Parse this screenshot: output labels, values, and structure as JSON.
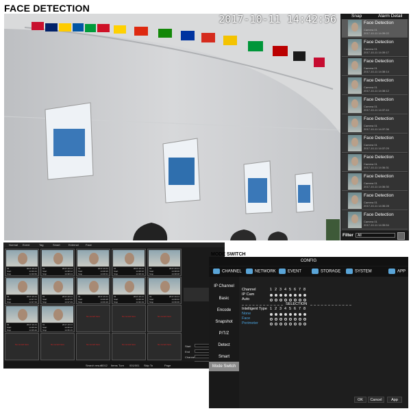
{
  "live_view": {
    "title": "FACE DETECTION",
    "timestamp": "2017-10-11 14:42:56",
    "tabs": {
      "snap": "Snap",
      "alarm_detail": "Alarm Detail"
    },
    "snaps": [
      {
        "event": "Face Detection",
        "camera": "Camera 01",
        "time": "2017-10-11 14:39:22"
      },
      {
        "event": "Face Detection",
        "camera": "Camera 01",
        "time": "2017-10-11 14:39:17"
      },
      {
        "event": "Face Detection",
        "camera": "Camera 01",
        "time": "2017-10-11 14:38:14"
      },
      {
        "event": "Face Detection",
        "camera": "Camera 01",
        "time": "2017-10-11 14:38:12"
      },
      {
        "event": "Face Detection",
        "camera": "Camera 01",
        "time": "2017-10-11 14:37:44"
      },
      {
        "event": "Face Detection",
        "camera": "Camera 01",
        "time": "2017-10-11 14:37:36"
      },
      {
        "event": "Face Detection",
        "camera": "Camera 01",
        "time": "2017-10-11 14:37:29"
      },
      {
        "event": "Face Detection",
        "camera": "Camera 01",
        "time": "2017-10-11 14:36:31"
      },
      {
        "event": "Face Detection",
        "camera": "Camera 01",
        "time": "2017-10-11 14:36:30"
      },
      {
        "event": "Face Detection",
        "camera": "Camera 01",
        "time": "2017-10-11 14:36:28"
      },
      {
        "event": "Face Detection",
        "camera": "Camera 01",
        "time": "2017-10-11 14:35:54"
      }
    ],
    "filter_label": "Filter",
    "filter_value": "All"
  },
  "search": {
    "tabs": [
      "Normal",
      "Event",
      "Tag",
      "Smart",
      "External",
      "Face"
    ],
    "cells": [
      {
        "ch": "01",
        "date": "2017-10-11",
        "start_lbl": "Start",
        "start": "14:39:44",
        "stop_lbl": "Stop",
        "stop": "14:39:50"
      },
      {
        "ch": "01",
        "date": "2017-10-11",
        "start_lbl": "Start",
        "start": "14:38:12",
        "stop_lbl": "Stop",
        "stop": "14:38:13"
      },
      {
        "ch": "01",
        "date": "2017-10-11",
        "start_lbl": "Start",
        "start": "14:38:25",
        "stop_lbl": "Stop",
        "stop": "14:38:31"
      },
      {
        "ch": "01",
        "date": "2017-10-11",
        "start_lbl": "Start",
        "start": "14:38:16",
        "stop_lbl": "Stop",
        "stop": "14:38:19"
      },
      {
        "ch": "01",
        "date": "2017-10-11",
        "start_lbl": "Start",
        "start": "14:38:06",
        "stop_lbl": "Stop",
        "stop": "14:38:08"
      },
      {
        "ch": "01",
        "date": "2017-10-11",
        "start_lbl": "Start",
        "start": "14:37:21",
        "stop_lbl": "Stop",
        "stop": "14:37:33"
      },
      {
        "ch": "01",
        "date": "2017-10-11",
        "start_lbl": "Start",
        "start": "14:37:05",
        "stop_lbl": "Stop",
        "stop": "14:37:09"
      },
      {
        "ch": "01",
        "date": "2017-10-11",
        "start_lbl": "Start",
        "start": "14:36:25",
        "stop_lbl": "Stop",
        "stop": "14:36:29"
      },
      {
        "ch": "01",
        "date": "2017-10-11",
        "start_lbl": "Start",
        "start": "14:36:16",
        "stop_lbl": "Stop",
        "stop": "14:36:19"
      },
      {
        "ch": "01",
        "date": "2017-10-11",
        "start_lbl": "Start",
        "start": "14:36:02",
        "stop_lbl": "Stop",
        "stop": "14:36:06"
      },
      {
        "ch": "01",
        "date": "2017-10-11",
        "start_lbl": "Start",
        "start": "14:35:34",
        "stop_lbl": "Stop",
        "stop": "14:35:40"
      },
      {
        "ch": "01",
        "date": "2017-10-11",
        "start_lbl": "Start",
        "start": "14:35:12",
        "stop_lbl": "Stop",
        "stop": "14:35:15"
      }
    ],
    "no_record": "No record here",
    "side": {
      "start": "Start",
      "end": "End",
      "channel": "Channel",
      "rec": "Rec"
    },
    "footer": {
      "result": "Search result",
      "result_val": "0012",
      "items": "Items",
      "turn": "Turn",
      "turn_val": "001/001",
      "skip_to": "Skip To",
      "page": "Page"
    }
  },
  "mode_switch": {
    "section_title": "MODE SWITCH",
    "config_title": "CONFIG",
    "tabs": [
      "CHANNEL",
      "NETWORK",
      "EVENT",
      "STORAGE",
      "SYSTEM",
      "APP"
    ],
    "side": [
      "IP Channel",
      "Basic",
      "Encode",
      "Snapshot",
      "P/T/Z",
      "Detect",
      "Smart",
      "Mode Switch"
    ],
    "channel_label": "Channel",
    "channels": [
      "1",
      "2",
      "3",
      "4",
      "5",
      "6",
      "7",
      "8"
    ],
    "ip_cam": "IP Cam",
    "auto": "Auto",
    "selection": "SELECTION",
    "intelligent_type": "Intelligent Type",
    "options": [
      "None",
      "Face",
      "Perimeter"
    ],
    "buttons": {
      "ok": "OK",
      "cancel": "Cancel",
      "app": "App"
    }
  },
  "colors": {
    "accent_blue": "#4aa3df",
    "no_record_red": "#dd2222",
    "panel_dark": "#191919"
  }
}
